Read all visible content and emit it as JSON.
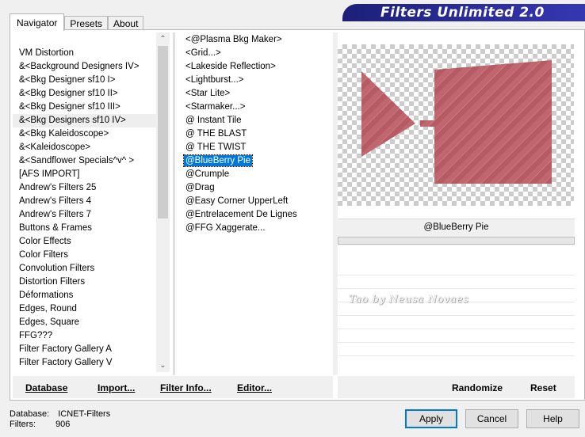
{
  "tabs": [
    "Navigator",
    "Presets",
    "About"
  ],
  "title": "Filters Unlimited 2.0",
  "categories": [
    "VM Distortion",
    "&<Background Designers IV>",
    "&<Bkg Designer sf10 I>",
    "&<Bkg Designer sf10 II>",
    "&<Bkg Designer sf10 III>",
    "&<Bkg Designers sf10 IV>",
    "&<Bkg Kaleidoscope>",
    "&<Kaleidoscope>",
    "&<Sandflower Specials^v^ >",
    "[AFS IMPORT]",
    "Andrew's Filters 25",
    "Andrew's Filters 4",
    "Andrew's Filters 7",
    "Buttons & Frames",
    "Color Effects",
    "Color Filters",
    "Convolution Filters",
    "Distortion Filters",
    "Déformations",
    "Edges, Round",
    "Edges, Square",
    "FFG???",
    "Filter Factory Gallery A",
    "Filter Factory Gallery V"
  ],
  "selected_category_index": 5,
  "filters": [
    "<@Plasma Bkg Maker>",
    "<Grid...>",
    "<Lakeside Reflection>",
    "<Lightburst...>",
    "<Star Lite>",
    "<Starmaker...>",
    "@ Instant Tile",
    "@ THE BLAST",
    "@ THE TWIST",
    "@BlueBerry Pie",
    "@Crumple",
    "@Drag",
    "@Easy Corner UpperLeft",
    "@Entrelacement De Lignes",
    "@FFG Xaggerate..."
  ],
  "selected_filter_index": 9,
  "current_filter_name": "@BlueBerry Pie",
  "watermark": "Tao by Neusa Novaes",
  "bottom_links": {
    "database": "Database",
    "import": "Import...",
    "filter_info": "Filter Info...",
    "editor": "Editor...",
    "randomize": "Randomize",
    "reset": "Reset"
  },
  "info": {
    "database_label": "Database:",
    "database_value": "ICNET-Filters",
    "filters_label": "Filters:",
    "filters_value": "906"
  },
  "buttons": {
    "apply": "Apply",
    "cancel": "Cancel",
    "help": "Help"
  },
  "icons": {
    "scroll_up": "chevron-up-icon",
    "scroll_down": "chevron-down-icon"
  },
  "colors": {
    "selection": "#0078d7",
    "banner": "#2c2e9c",
    "preview_shape": "#c0666e"
  }
}
